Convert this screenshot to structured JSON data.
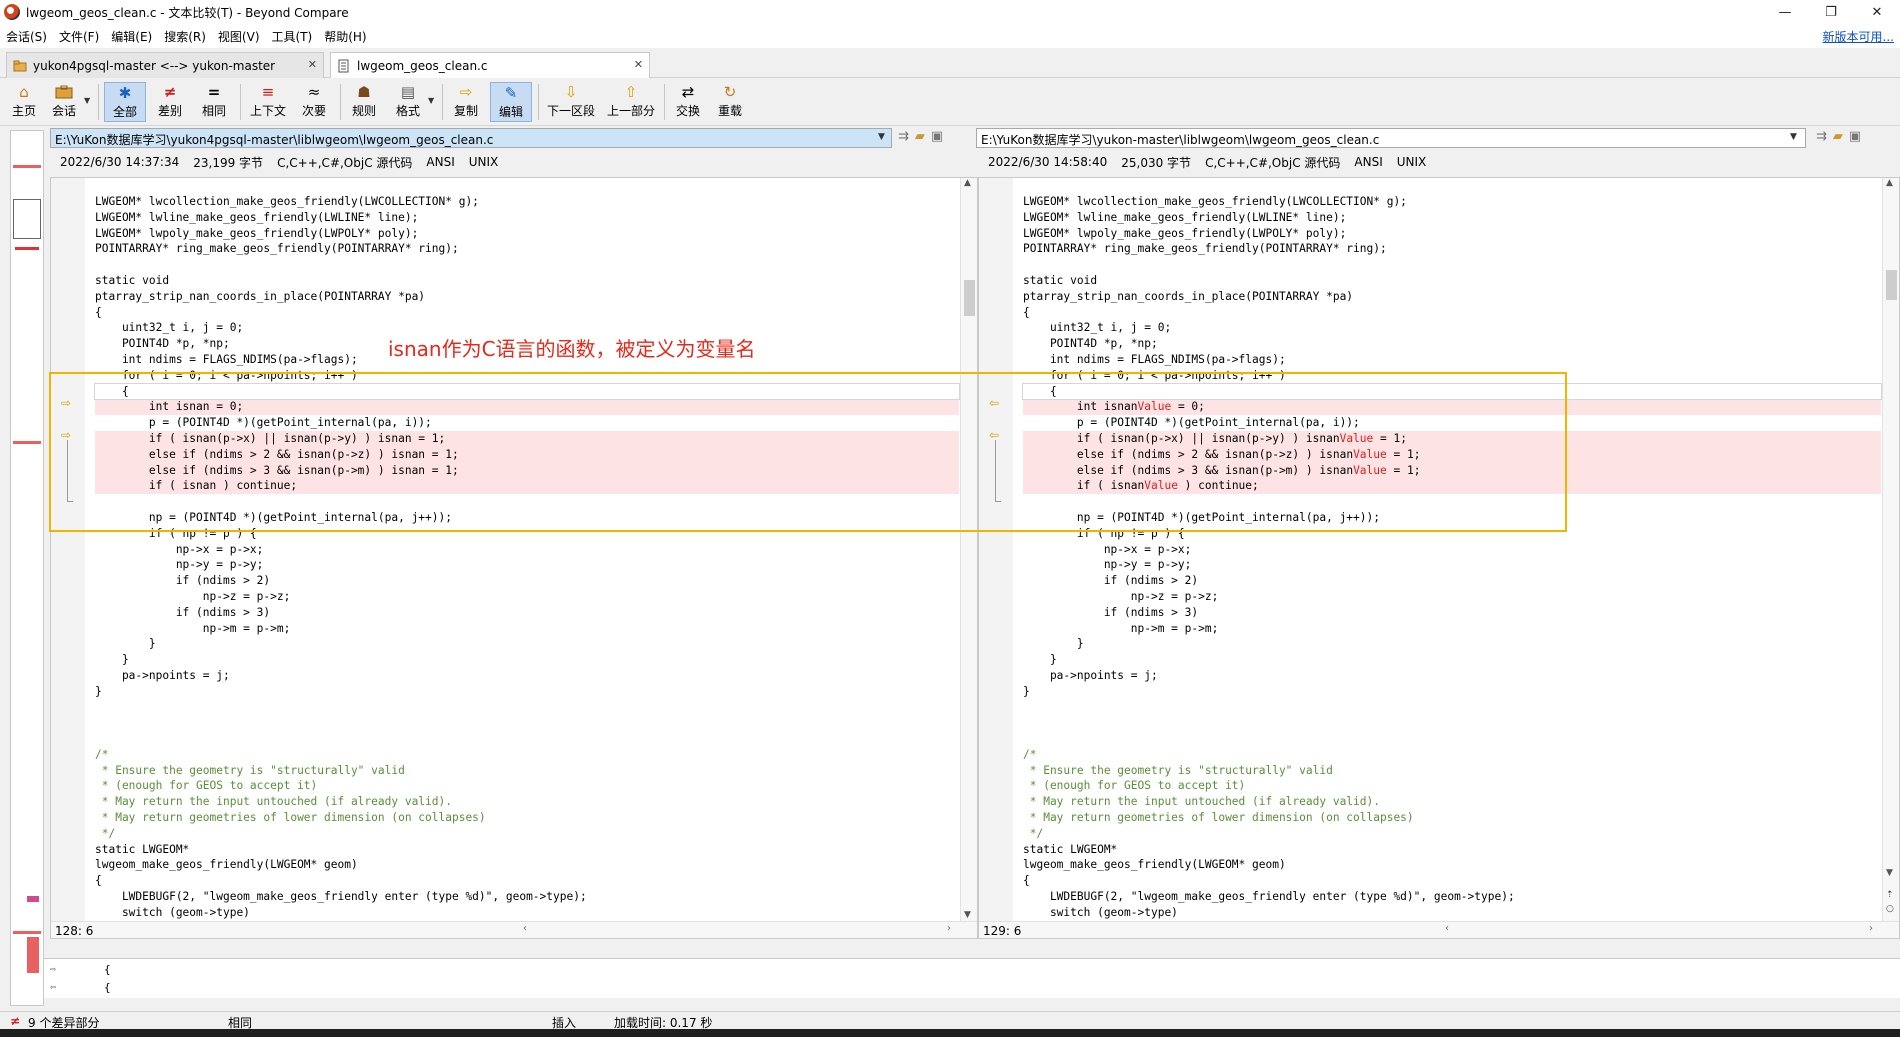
{
  "window": {
    "title": "lwgeom_geos_clean.c - 文本比较(T) - Beyond Compare",
    "minimize": "—",
    "maximize": "❐",
    "close": "✕"
  },
  "menu": {
    "items": [
      "会话(S)",
      "文件(F)",
      "编辑(E)",
      "搜索(R)",
      "视图(V)",
      "工具(T)",
      "帮助(H)"
    ],
    "update_link": "新版本可用..."
  },
  "tabs": [
    {
      "label": "yukon4pgsql-master <--> yukon-master",
      "icon": "folder-compare-icon"
    },
    {
      "label": "lwgeom_geos_clean.c",
      "icon": "file-compare-icon"
    }
  ],
  "toolbar": {
    "home": "主页",
    "session": "会话",
    "all": "全部",
    "diffs": "差别",
    "same": "相同",
    "context": "上下文",
    "minor": "次要",
    "rules": "规则",
    "format": "格式",
    "copy": "复制",
    "edit": "编辑",
    "next_section": "下一区段",
    "prev_section": "上一部分",
    "swap": "交换",
    "reload": "重载"
  },
  "left": {
    "path": "E:\\YuKon数据库学习\\yukon4pgsql-master\\liblwgeom\\lwgeom_geos_clean.c",
    "timestamp": "2022/6/30 14:37:34",
    "size": "23,199 字节",
    "format": "C,C++,C#,ObjC 源代码",
    "encoding": "ANSI",
    "line_ending": "UNIX",
    "position": "128: 6"
  },
  "right": {
    "path": "E:\\YuKon数据库学习\\yukon-master\\liblwgeom\\lwgeom_geos_clean.c",
    "timestamp": "2022/6/30 14:58:40",
    "size": "25,030 字节",
    "format": "C,C++,C#,ObjC 源代码",
    "encoding": "ANSI",
    "line_ending": "UNIX",
    "position": "129: 6"
  },
  "annotation": "isnan作为C语言的函数，被定义为变量名",
  "detail": {
    "line1": "{",
    "line2": "{"
  },
  "status": {
    "diff_count": "9 个差异部分",
    "same": "相同",
    "mode": "插入",
    "load_time": "加载时间:  0.17 秒"
  },
  "colors": {
    "diff_bg": "#fde3e3",
    "highlight": "#e01f1f",
    "annotation": "#e8281a",
    "annotation_box": "#f3b400"
  },
  "code_left": [
    {
      "t": "LWGEOM* lwcollection_make_geos_friendly(LWCOLLECTION* g);"
    },
    {
      "t": "LWGEOM* lwline_make_geos_friendly(LWLINE* line);"
    },
    {
      "t": "LWGEOM* lwpoly_make_geos_friendly(LWPOLY* poly);"
    },
    {
      "t": "POINTARRAY* ring_make_geos_friendly(POINTARRAY* ring);"
    },
    {
      "t": ""
    },
    {
      "t": "static void"
    },
    {
      "t": "ptarray_strip_nan_coords_in_place(POINTARRAY *pa)"
    },
    {
      "t": "{"
    },
    {
      "t": "    uint32_t i, j = 0;"
    },
    {
      "t": "    POINT4D *p, *np;"
    },
    {
      "t": "    int ndims = FLAGS_NDIMS(pa->flags);"
    },
    {
      "t": "    for ( i = 0; i < pa->npoints; i++ )"
    },
    {
      "t": "    {",
      "c": "cursor"
    },
    {
      "t": "        int isnan = 0;",
      "c": "diff"
    },
    {
      "t": "        p = (POINT4D *)(getPoint_internal(pa, i));"
    },
    {
      "t": "        if ( isnan(p->x) || isnan(p->y) ) isnan = 1;",
      "c": "diff"
    },
    {
      "t": "        else if (ndims > 2 && isnan(p->z) ) isnan = 1;",
      "c": "diff"
    },
    {
      "t": "        else if (ndims > 3 && isnan(p->m) ) isnan = 1;",
      "c": "diff"
    },
    {
      "t": "        if ( isnan ) continue;",
      "c": "diff"
    },
    {
      "t": ""
    },
    {
      "t": "        np = (POINT4D *)(getPoint_internal(pa, j++));"
    },
    {
      "t": "        if ( np != p ) {"
    },
    {
      "t": "            np->x = p->x;"
    },
    {
      "t": "            np->y = p->y;"
    },
    {
      "t": "            if (ndims > 2)"
    },
    {
      "t": "                np->z = p->z;"
    },
    {
      "t": "            if (ndims > 3)"
    },
    {
      "t": "                np->m = p->m;"
    },
    {
      "t": "        }"
    },
    {
      "t": "    }"
    },
    {
      "t": "    pa->npoints = j;"
    },
    {
      "t": "}"
    },
    {
      "t": ""
    },
    {
      "t": ""
    },
    {
      "t": ""
    },
    {
      "t": "/*"
    },
    {
      "t": " * Ensure the geometry is \"structurally\" valid"
    },
    {
      "t": " * (enough for GEOS to accept it)"
    },
    {
      "t": " * May return the input untouched (if already valid)."
    },
    {
      "t": " * May return geometries of lower dimension (on collapses)"
    },
    {
      "t": " */"
    },
    {
      "t": "static LWGEOM*"
    },
    {
      "t": "lwgeom_make_geos_friendly(LWGEOM* geom)"
    },
    {
      "t": "{"
    },
    {
      "t": "    LWDEBUGF(2, \"lwgeom_make_geos_friendly enter (type %d)\", geom->type);"
    },
    {
      "t": "    switch (geom->type)"
    },
    {
      "t": "    {"
    }
  ],
  "code_right": [
    {
      "t": "LWGEOM* lwcollection_make_geos_friendly(LWCOLLECTION* g);"
    },
    {
      "t": "LWGEOM* lwline_make_geos_friendly(LWLINE* line);"
    },
    {
      "t": "LWGEOM* lwpoly_make_geos_friendly(LWPOLY* poly);"
    },
    {
      "t": "POINTARRAY* ring_make_geos_friendly(POINTARRAY* ring);"
    },
    {
      "t": ""
    },
    {
      "t": "static void"
    },
    {
      "t": "ptarray_strip_nan_coords_in_place(POINTARRAY *pa)"
    },
    {
      "t": "{"
    },
    {
      "t": "    uint32_t i, j = 0;"
    },
    {
      "t": "    POINT4D *p, *np;"
    },
    {
      "t": "    int ndims = FLAGS_NDIMS(pa->flags);"
    },
    {
      "t": "    for ( i = 0; i < pa->npoints; i++ )"
    },
    {
      "t": "    {",
      "c": "cursor"
    },
    {
      "t": "        int isnanValue = 0;",
      "c": "diff"
    },
    {
      "t": "        p = (POINT4D *)(getPoint_internal(pa, i));"
    },
    {
      "t": "        if ( isnan(p->x) || isnan(p->y) ) isnanValue = 1;",
      "c": "diff"
    },
    {
      "t": "        else if (ndims > 2 && isnan(p->z) ) isnanValue = 1;",
      "c": "diff"
    },
    {
      "t": "        else if (ndims > 3 && isnan(p->m) ) isnanValue = 1;",
      "c": "diff"
    },
    {
      "t": "        if ( isnanValue ) continue;",
      "c": "diff"
    },
    {
      "t": ""
    },
    {
      "t": "        np = (POINT4D *)(getPoint_internal(pa, j++));"
    },
    {
      "t": "        if ( np != p ) {"
    },
    {
      "t": "            np->x = p->x;"
    },
    {
      "t": "            np->y = p->y;"
    },
    {
      "t": "            if (ndims > 2)"
    },
    {
      "t": "                np->z = p->z;"
    },
    {
      "t": "            if (ndims > 3)"
    },
    {
      "t": "                np->m = p->m;"
    },
    {
      "t": "        }"
    },
    {
      "t": "    }"
    },
    {
      "t": "    pa->npoints = j;"
    },
    {
      "t": "}"
    },
    {
      "t": ""
    },
    {
      "t": ""
    },
    {
      "t": ""
    },
    {
      "t": "/*"
    },
    {
      "t": " * Ensure the geometry is \"structurally\" valid"
    },
    {
      "t": " * (enough for GEOS to accept it)"
    },
    {
      "t": " * May return the input untouched (if already valid)."
    },
    {
      "t": " * May return geometries of lower dimension (on collapses)"
    },
    {
      "t": " */"
    },
    {
      "t": "static LWGEOM*"
    },
    {
      "t": "lwgeom_make_geos_friendly(LWGEOM* geom)"
    },
    {
      "t": "{"
    },
    {
      "t": "    LWDEBUGF(2, \"lwgeom_make_geos_friendly enter (type %d)\", geom->type);"
    },
    {
      "t": "    switch (geom->type)"
    },
    {
      "t": "    {"
    }
  ]
}
